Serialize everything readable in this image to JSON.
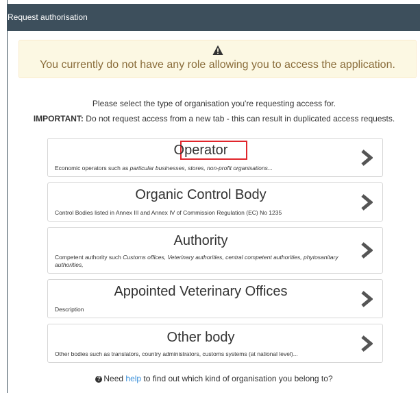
{
  "header": {
    "title": "Request authorisation"
  },
  "warning": {
    "icon": "warning-triangle-icon",
    "message": "You currently do not have any role allowing you to access the application."
  },
  "intro": "Please select the type of organisation you're requesting access for.",
  "important": {
    "label": "IMPORTANT:",
    "text": " Do not request access from a new tab - this can result in duplicated access requests."
  },
  "cards": [
    {
      "title": "Operator",
      "desc_plain": "Economic operators such as ",
      "desc_italic": "particular businesses, stores, non-profit organisations..."
    },
    {
      "title": "Organic Control Body",
      "desc_plain": "Control Bodies listed in Annex III and Annex IV of Commission Regulation (EC) No 1235",
      "desc_italic": ""
    },
    {
      "title": "Authority",
      "desc_plain": "Competent authority such ",
      "desc_italic": "Customs offices, Veterinary authorities, central competent authorities, phytosanitary authorities,"
    },
    {
      "title": "Appointed Veterinary Offices",
      "desc_plain": "Description",
      "desc_italic": ""
    },
    {
      "title": "Other body",
      "desc_plain": "Other bodies such as translators, country administrators, customs systems (at national level)...",
      "desc_italic": ""
    }
  ],
  "help": {
    "icon": "question-circle-icon",
    "before": "Need ",
    "link": "help",
    "after": " to find out which kind of organisation you belong to?"
  },
  "colors": {
    "header_bg": "#3d4f5c",
    "warning_bg": "#fcf8e3",
    "warning_text": "#8a6d3b",
    "highlight_border": "#e0252b",
    "link": "#3a8fd9"
  }
}
